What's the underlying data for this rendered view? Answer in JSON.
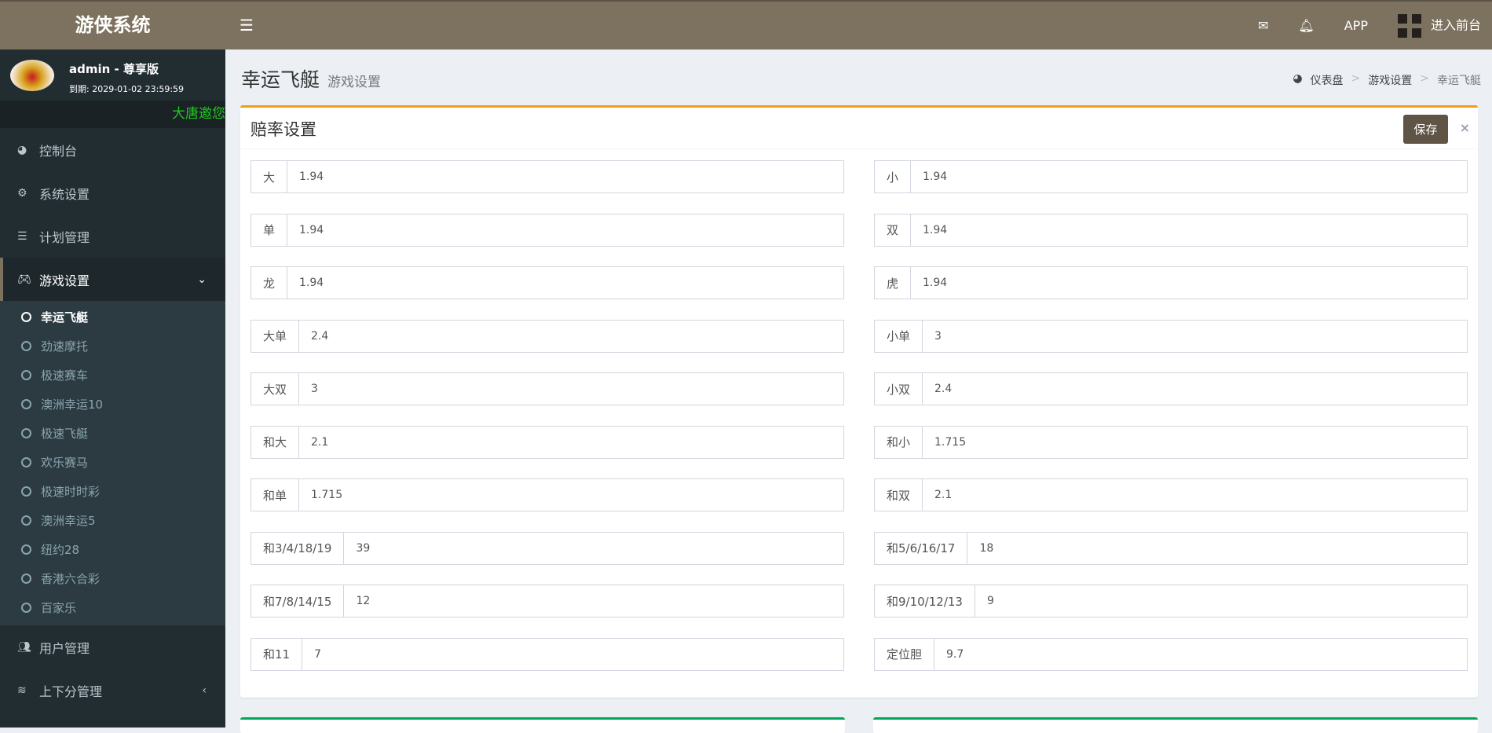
{
  "header": {
    "logo": "游侠系统",
    "app": "APP",
    "frontend": "进入前台"
  },
  "user": {
    "name": "admin - 尊享版",
    "expiry": "到期: 2029-01-02 23:59:59",
    "marquee": "大唐邀您"
  },
  "sidebar": {
    "items": [
      {
        "label": "控制台",
        "icon": "dashboard-icon"
      },
      {
        "label": "系统设置",
        "icon": "gears-icon"
      },
      {
        "label": "计划管理",
        "icon": "list-ol-icon"
      },
      {
        "label": "游戏设置",
        "icon": "gamepad-icon"
      },
      {
        "label": "用户管理",
        "icon": "users-icon"
      },
      {
        "label": "上下分管理",
        "icon": "database-icon"
      }
    ],
    "sub": [
      "幸运飞艇",
      "劲速摩托",
      "极速赛车",
      "澳洲幸运10",
      "极速飞艇",
      "欢乐赛马",
      "极速时时彩",
      "澳洲幸运5",
      "纽约28",
      "香港六合彩",
      "百家乐"
    ]
  },
  "page": {
    "title": "幸运飞艇",
    "subtitle": "游戏设置",
    "breadcrumb": [
      "仪表盘",
      "游戏设置",
      "幸运飞艇"
    ]
  },
  "box": {
    "title": "赔率设置",
    "save": "保存",
    "close": "×"
  },
  "fields": [
    {
      "label": "大",
      "value": "1.94"
    },
    {
      "label": "小",
      "value": "1.94"
    },
    {
      "label": "单",
      "value": "1.94"
    },
    {
      "label": "双",
      "value": "1.94"
    },
    {
      "label": "龙",
      "value": "1.94"
    },
    {
      "label": "虎",
      "value": "1.94"
    },
    {
      "label": "大单",
      "value": "2.4"
    },
    {
      "label": "小单",
      "value": "3"
    },
    {
      "label": "大双",
      "value": "3"
    },
    {
      "label": "小双",
      "value": "2.4"
    },
    {
      "label": "和大",
      "value": "2.1"
    },
    {
      "label": "和小",
      "value": "1.715"
    },
    {
      "label": "和单",
      "value": "1.715"
    },
    {
      "label": "和双",
      "value": "2.1"
    },
    {
      "label": "和3/4/18/19",
      "value": "39"
    },
    {
      "label": "和5/6/16/17",
      "value": "18"
    },
    {
      "label": "和7/8/14/15",
      "value": "12"
    },
    {
      "label": "和9/10/12/13",
      "value": "9"
    },
    {
      "label": "和11",
      "value": "7"
    },
    {
      "label": "定位胆",
      "value": "9.7"
    }
  ],
  "colors": {
    "header": "#7d725f",
    "sidebar": "#222d32",
    "accent": "#f39c12",
    "save": "#5f5445",
    "marquee": "#1ec81e"
  }
}
